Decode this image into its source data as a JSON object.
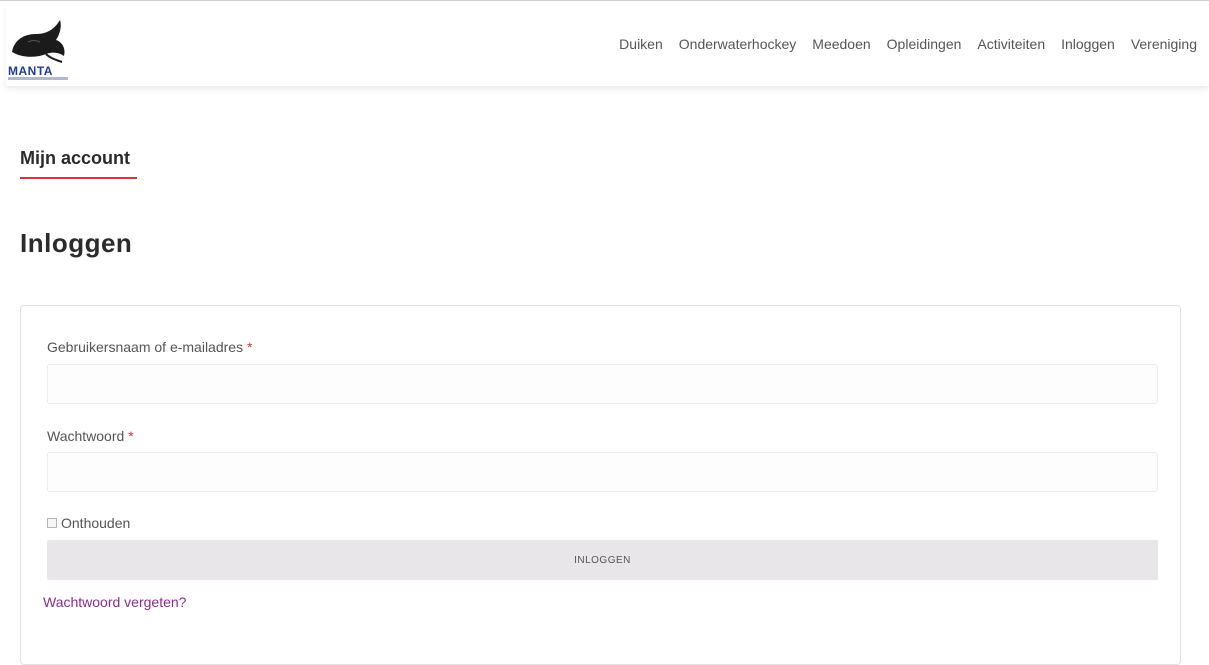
{
  "header": {
    "logo_text": "MANTA",
    "nav": [
      {
        "label": "Duiken"
      },
      {
        "label": "Onderwaterhockey"
      },
      {
        "label": "Meedoen"
      },
      {
        "label": "Opleidingen"
      },
      {
        "label": "Activiteiten"
      },
      {
        "label": "Inloggen"
      },
      {
        "label": "Vereniging"
      }
    ]
  },
  "main": {
    "breadcrumb_title": "Mijn account",
    "page_title": "Inloggen",
    "form": {
      "username_label": "Gebruikersnaam of e-mailadres",
      "username_value": "",
      "password_label": "Wachtwoord",
      "password_value": "",
      "required_marker": "*",
      "remember_label": "Onthouden",
      "remember_checked": false,
      "submit_label": "INLOGGEN",
      "forgot_label": "Wachtwoord vergeten?"
    }
  },
  "colors": {
    "accent_red": "#d9353a",
    "link_purple": "#8a2e8e",
    "brand_blue": "#1f3f8f",
    "button_gray": "#e8e6e8"
  },
  "icons": {
    "logo": "manta-ray-logo-icon"
  }
}
